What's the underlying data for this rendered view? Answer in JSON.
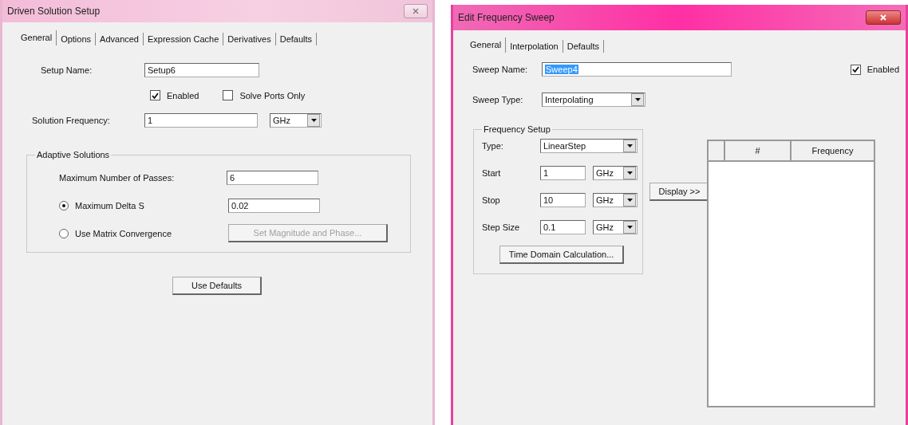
{
  "setup_dialog": {
    "title": "Driven Solution Setup",
    "tabs": [
      {
        "label": "General",
        "selected": true
      },
      {
        "label": "Options",
        "selected": false
      },
      {
        "label": "Advanced",
        "selected": false
      },
      {
        "label": "Expression Cache",
        "selected": false
      },
      {
        "label": "Derivatives",
        "selected": false
      },
      {
        "label": "Defaults",
        "selected": false
      }
    ],
    "setup_name": {
      "label": "Setup Name:",
      "value": "Setup6"
    },
    "checkboxes": [
      {
        "label": "Enabled",
        "checked": true
      },
      {
        "label": "Solve Ports Only",
        "checked": false
      }
    ],
    "solution_frequency": {
      "label": "Solution Frequency:",
      "value": "1",
      "unit": "GHz"
    },
    "adaptive_solutions": {
      "title": "Adaptive Solutions",
      "passes": {
        "label": "Maximum Number of Passes:",
        "value": "6"
      },
      "options": [
        {
          "kind": "field",
          "label": "Maximum Delta S",
          "selected": true,
          "value": "0.02"
        },
        {
          "kind": "button",
          "label": "Use Matrix Convergence",
          "selected": false,
          "button": "Set Magnitude and Phase...",
          "disabled": true
        }
      ]
    },
    "use_defaults_button": "Use Defaults"
  },
  "sweep_dialog": {
    "title": "Edit Frequency Sweep",
    "tabs": [
      {
        "label": "General",
        "selected": true
      },
      {
        "label": "Interpolation",
        "selected": false
      },
      {
        "label": "Defaults",
        "selected": false
      }
    ],
    "sweep_name": {
      "label": "Sweep Name:",
      "value": "Sweep4",
      "text_selected": true
    },
    "enabled": {
      "label": "Enabled",
      "checked": true
    },
    "sweep_type": {
      "label": "Sweep Type:",
      "value": "Interpolating"
    },
    "frequency_setup": {
      "title": "Frequency Setup",
      "type": {
        "label": "Type:",
        "value": "LinearStep"
      },
      "rows": [
        {
          "label": "Start",
          "value": "1",
          "unit": "GHz"
        },
        {
          "label": "Stop",
          "value": "10",
          "unit": "GHz"
        },
        {
          "label": "Step Size",
          "value": "0.1",
          "unit": "GHz"
        }
      ],
      "button": "Time Domain Calculation..."
    },
    "display_button": "Display >>",
    "table": {
      "columns": [
        "#",
        "Frequency"
      ]
    }
  }
}
